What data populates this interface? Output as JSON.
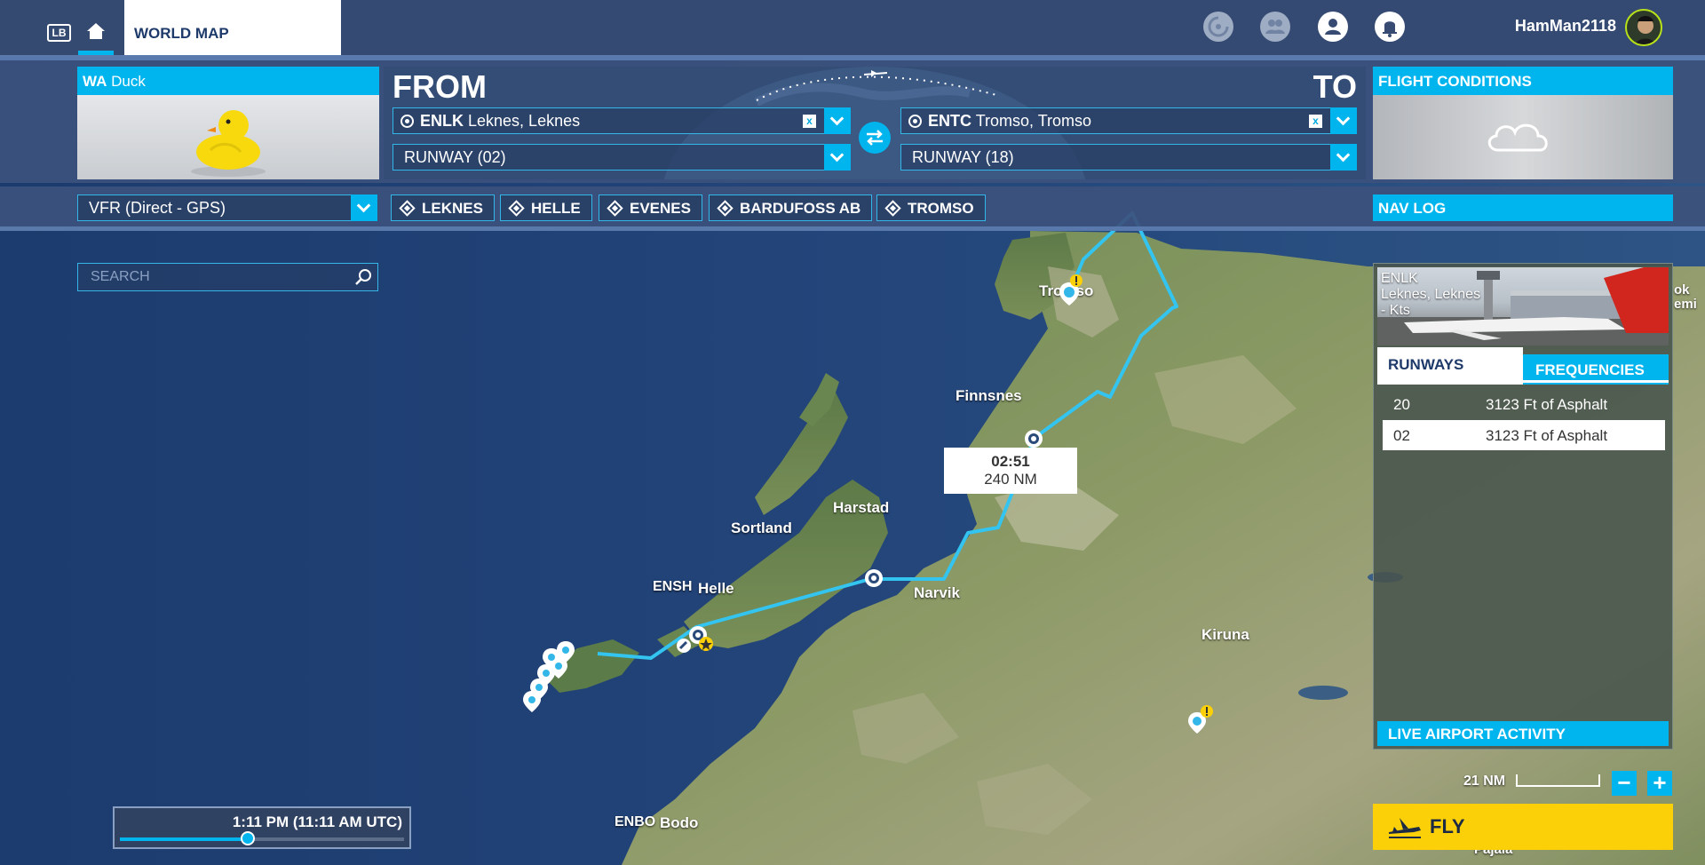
{
  "topbar": {
    "lb_badge": "LB",
    "worldmap_tab": "WORLD MAP",
    "username": "HamMan2118"
  },
  "aircraft": {
    "manufacturer": "WA",
    "name": "Duck"
  },
  "route": {
    "from_label": "FROM",
    "to_label": "TO",
    "departure_icao": "ENLK",
    "departure_name": "Leknes, Leknes",
    "arrival_icao": "ENTC",
    "arrival_name": "Tromso, Tromso",
    "departure_runway": "RUNWAY (02)",
    "arrival_runway": "RUNWAY (18)",
    "clear_glyph": "x"
  },
  "conditions": {
    "title": "FLIGHT CONDITIONS",
    "weather_icon": "cloud-icon"
  },
  "flight_plan": {
    "type": "VFR (Direct - GPS)",
    "waypoints": [
      "LEKNES",
      "HELLE",
      "EVENES",
      "BARDUFOSS AB",
      "TROMSO"
    ]
  },
  "navlog": {
    "title": "NAV LOG",
    "airport_icao": "ENLK",
    "airport_name": "Leknes, Leknes",
    "airport_info": "- Kts",
    "tabs": [
      "RUNWAYS",
      "FREQUENCIES"
    ],
    "runways": [
      {
        "id": "20",
        "desc": "3123 Ft of Asphalt"
      },
      {
        "id": "02",
        "desc": "3123 Ft of Asphalt"
      }
    ],
    "live_activity": "LIVE AIRPORT ACTIVITY"
  },
  "search": {
    "placeholder": "SEARCH"
  },
  "map": {
    "places": {
      "tromso": "Tromso",
      "finnsnes": "Finnsnes",
      "harstad": "Harstad",
      "sortland": "Sortland",
      "helle": "Helle",
      "narvik": "Narvik",
      "kiruna": "Kiruna",
      "bodo": "Bodo",
      "pajala": "Pajala",
      "edge_1": "ok",
      "edge_2": "emi"
    },
    "icaos": {
      "ensh": "ENSH",
      "enbo": "ENBO"
    },
    "route_time": "02:51",
    "route_distance": "240 NM",
    "scale": "21 NM",
    "accent": "#00b4ee",
    "route_color": "#33c4f0"
  },
  "zoom": {
    "minus": "−",
    "plus": "+"
  },
  "time": {
    "label": "1:11 PM (11:11 AM UTC)",
    "day_fraction": 0.45
  },
  "fly": {
    "label": "FLY"
  }
}
